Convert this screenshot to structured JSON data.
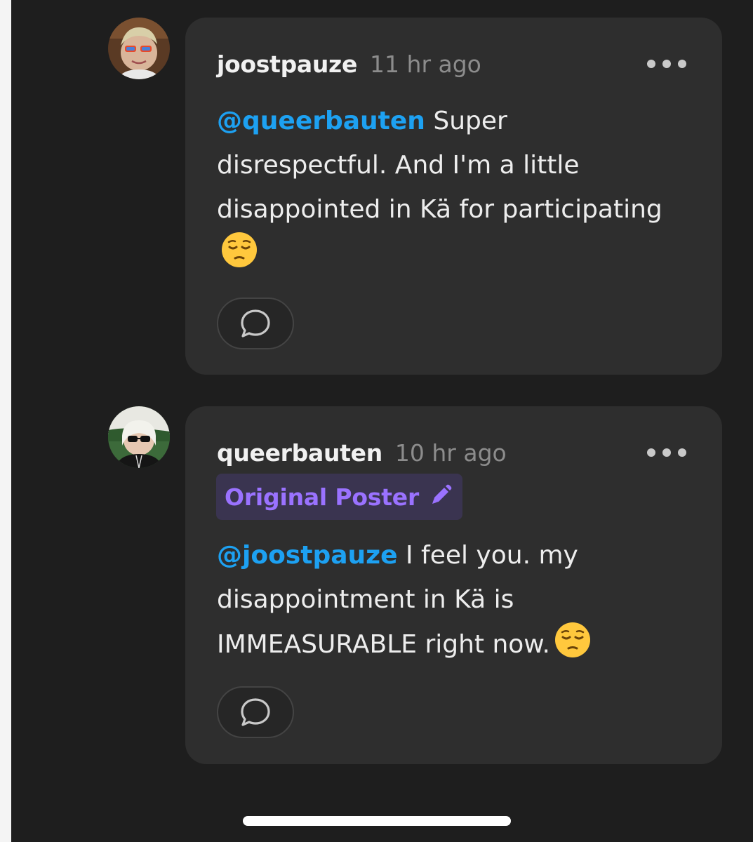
{
  "comments": [
    {
      "username": "joostpauze",
      "timestamp": "11 hr ago",
      "mention": "@queerbauten",
      "text": " Super disrespectful. And I'm a little disappointed in Kä for participating",
      "emoji": "pensive-face",
      "avatar": "avatar-joostpauze",
      "reply_icon": "speech-bubble-icon",
      "more_icon": "more-dots-icon"
    },
    {
      "username": "queerbauten",
      "timestamp": "10 hr ago",
      "badge": "Original Poster",
      "badge_icon": "pencil-icon",
      "mention": "@joostpauze",
      "text": " I feel you. my disappointment in Kä is IMMEASURABLE right now.",
      "emoji": "pensive-face",
      "avatar": "avatar-queerbauten",
      "reply_icon": "speech-bubble-icon",
      "more_icon": "more-dots-icon"
    }
  ],
  "colors": {
    "background": "#1e1e1e",
    "card": "#2e2e2e",
    "mention": "#1da1f2",
    "badge_text": "#9a72ff",
    "badge_bg": "#3a3450",
    "timestamp": "#8c8c8c"
  }
}
